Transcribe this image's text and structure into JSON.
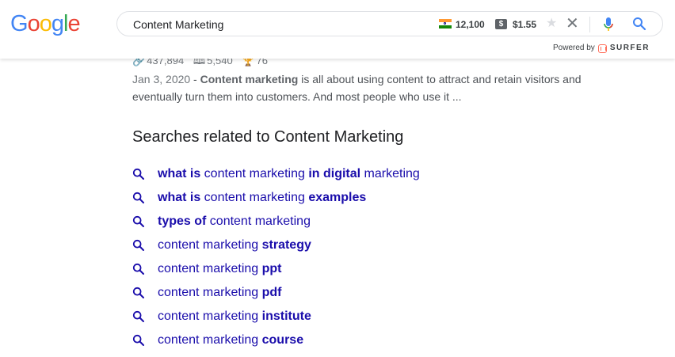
{
  "logo": {
    "text": "Google",
    "letters": [
      "G",
      "o",
      "o",
      "g",
      "l",
      "e"
    ]
  },
  "search": {
    "query": "Content Marketing"
  },
  "metrics": {
    "volume": "12,100",
    "cpc": "$1.55",
    "flag_icon": "india-flag-icon",
    "cpc_icon": "dollar-badge-icon"
  },
  "powered": {
    "label": "Powered by",
    "brand": "SURFER"
  },
  "result_stats": {
    "links": "437,894",
    "pages": "5,540",
    "score": "76"
  },
  "snippet": {
    "date": "Jan 3, 2020",
    "separator": " - ",
    "bold": "Content marketing",
    "rest": " is all about using content to attract and retain visitors and eventually turn them into customers. And most people who use it ..."
  },
  "related": {
    "title": "Searches related to Content Marketing",
    "items": [
      [
        {
          "t": "what is",
          "b": true
        },
        {
          "t": " content marketing ",
          "b": false
        },
        {
          "t": "in digital",
          "b": true
        },
        {
          "t": " marketing",
          "b": false
        }
      ],
      [
        {
          "t": "what is",
          "b": true
        },
        {
          "t": " content marketing ",
          "b": false
        },
        {
          "t": "examples",
          "b": true
        }
      ],
      [
        {
          "t": "types of",
          "b": true
        },
        {
          "t": " content marketing",
          "b": false
        }
      ],
      [
        {
          "t": "content marketing ",
          "b": false
        },
        {
          "t": "strategy",
          "b": true
        }
      ],
      [
        {
          "t": "content marketing ",
          "b": false
        },
        {
          "t": "ppt",
          "b": true
        }
      ],
      [
        {
          "t": "content marketing ",
          "b": false
        },
        {
          "t": "pdf",
          "b": true
        }
      ],
      [
        {
          "t": "content marketing ",
          "b": false
        },
        {
          "t": "institute",
          "b": true
        }
      ],
      [
        {
          "t": "content marketing ",
          "b": false
        },
        {
          "t": "course",
          "b": true
        }
      ]
    ]
  },
  "colors": {
    "link": "#1a0dab",
    "accent_blue": "#4285f4",
    "surfer": "#ff6b57"
  }
}
